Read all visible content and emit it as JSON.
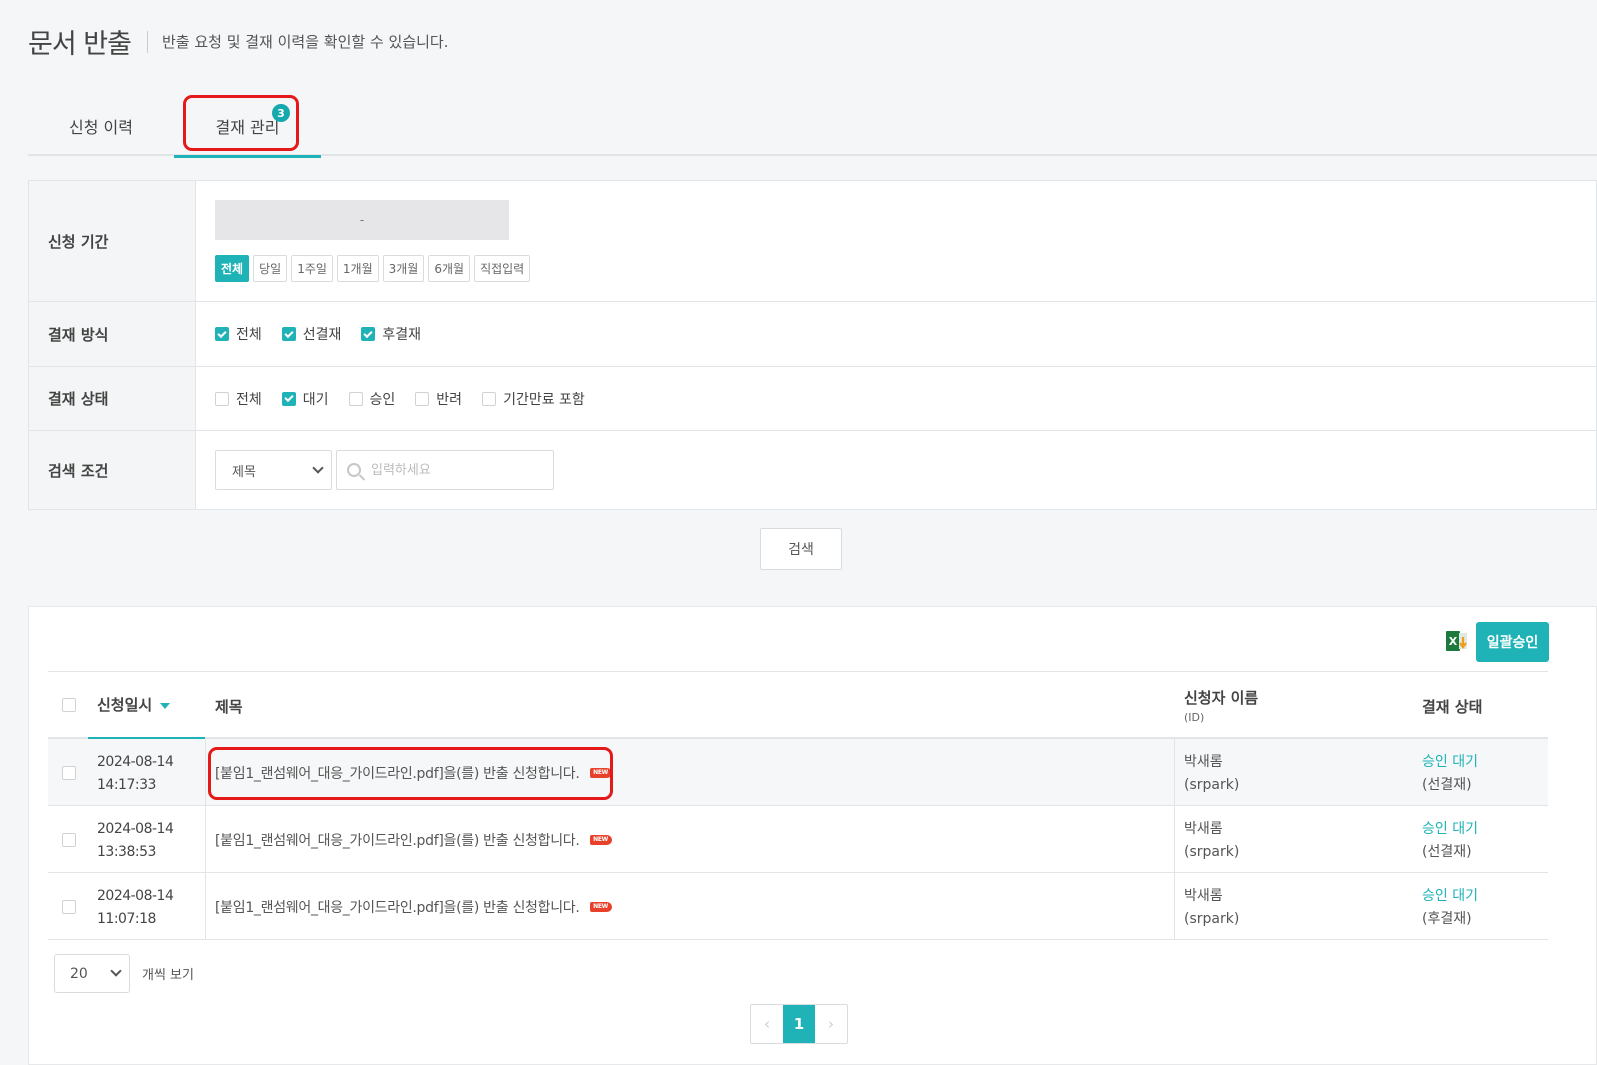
{
  "header": {
    "title": "문서 반출",
    "description": "반출 요청 및 결재 이력을 확인할 수 있습니다."
  },
  "tabs": [
    {
      "label": "신청 이력",
      "active": false
    },
    {
      "label": "결재 관리",
      "active": true,
      "badge": "3"
    }
  ],
  "filters": {
    "period": {
      "label": "신청 기간",
      "range_separator": "-",
      "buttons": [
        "전체",
        "당일",
        "1주일",
        "1개월",
        "3개월",
        "6개월",
        "직접입력"
      ],
      "active_button": "전체"
    },
    "method": {
      "label": "결재 방식",
      "options": [
        {
          "label": "전체",
          "checked": true
        },
        {
          "label": "선결재",
          "checked": true
        },
        {
          "label": "후결재",
          "checked": true
        }
      ]
    },
    "status": {
      "label": "결재 상태",
      "options": [
        {
          "label": "전체",
          "checked": false
        },
        {
          "label": "대기",
          "checked": true
        },
        {
          "label": "승인",
          "checked": false
        },
        {
          "label": "반려",
          "checked": false
        },
        {
          "label": "기간만료 포함",
          "checked": false
        }
      ]
    },
    "condition": {
      "label": "검색 조건",
      "select_value": "제목",
      "input_value": "",
      "input_placeholder": "입력하세요"
    }
  },
  "search_button": "검색",
  "list": {
    "bulk_approve_label": "일괄승인",
    "columns": {
      "date": "신청일시",
      "title": "제목",
      "user": "신청자 이름",
      "user_sub": "(ID)",
      "status": "결재 상태"
    },
    "rows": [
      {
        "date": "2024-08-14",
        "time": "14:17:33",
        "title": "[붙임1_랜섬웨어_대응_가이드라인.pdf]을(를) 반출 신청합니다.",
        "new_tag": "NEW",
        "user": "박새롬",
        "user_id": "(srpark)",
        "status": "승인 대기",
        "method": "(선결재)"
      },
      {
        "date": "2024-08-14",
        "time": "13:38:53",
        "title": "[붙임1_랜섬웨어_대응_가이드라인.pdf]을(를) 반출 신청합니다.",
        "new_tag": "NEW",
        "user": "박새롬",
        "user_id": "(srpark)",
        "status": "승인 대기",
        "method": "(선결재)"
      },
      {
        "date": "2024-08-14",
        "time": "11:07:18",
        "title": "[붙임1_랜섬웨어_대응_가이드라인.pdf]을(를) 반출 신청합니다.",
        "new_tag": "NEW",
        "user": "박새롬",
        "user_id": "(srpark)",
        "status": "승인 대기",
        "method": "(후결재)"
      }
    ],
    "page_size": "20",
    "page_size_label": "개씩 보기",
    "pages": {
      "prev": "‹",
      "current": "1",
      "next": "›"
    }
  },
  "colors": {
    "accent": "#1fb3b8",
    "highlight": "#e51919",
    "new_tag": "#e8412b"
  }
}
